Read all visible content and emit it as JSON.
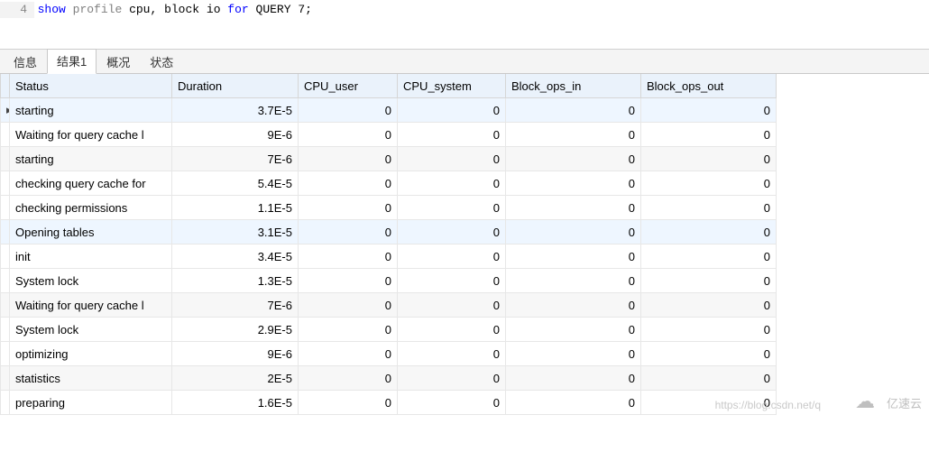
{
  "editor": {
    "line_no": "4",
    "tok_show": "show",
    "tok_profile": "profile",
    "tok_mid": " cpu, block io ",
    "tok_for": "for",
    "tok_query": " QUERY ",
    "tok_tail": "7;"
  },
  "tabs": {
    "info": "信息",
    "result1": "结果1",
    "overview": "概况",
    "status": "状态"
  },
  "columns": {
    "status": "Status",
    "duration": "Duration",
    "cpu_user": "CPU_user",
    "cpu_system": "CPU_system",
    "block_ops_in": "Block_ops_in",
    "block_ops_out": "Block_ops_out"
  },
  "rows": [
    {
      "status": "starting",
      "duration": "3.7E-5",
      "cpu_user": "0",
      "cpu_system": "0",
      "in": "0",
      "out": "0",
      "mark": "▸",
      "hl": true
    },
    {
      "status": "Waiting for query cache l",
      "duration": "9E-6",
      "cpu_user": "0",
      "cpu_system": "0",
      "in": "0",
      "out": "0"
    },
    {
      "status": "starting",
      "duration": "7E-6",
      "cpu_user": "0",
      "cpu_system": "0",
      "in": "0",
      "out": "0",
      "even": true
    },
    {
      "status": "checking query cache for",
      "duration": "5.4E-5",
      "cpu_user": "0",
      "cpu_system": "0",
      "in": "0",
      "out": "0"
    },
    {
      "status": "checking permissions",
      "duration": "1.1E-5",
      "cpu_user": "0",
      "cpu_system": "0",
      "in": "0",
      "out": "0"
    },
    {
      "status": "Opening tables",
      "duration": "3.1E-5",
      "cpu_user": "0",
      "cpu_system": "0",
      "in": "0",
      "out": "0",
      "hl": true
    },
    {
      "status": "init",
      "duration": "3.4E-5",
      "cpu_user": "0",
      "cpu_system": "0",
      "in": "0",
      "out": "0"
    },
    {
      "status": "System lock",
      "duration": "1.3E-5",
      "cpu_user": "0",
      "cpu_system": "0",
      "in": "0",
      "out": "0"
    },
    {
      "status": "Waiting for query cache l",
      "duration": "7E-6",
      "cpu_user": "0",
      "cpu_system": "0",
      "in": "0",
      "out": "0",
      "even": true
    },
    {
      "status": "System lock",
      "duration": "2.9E-5",
      "cpu_user": "0",
      "cpu_system": "0",
      "in": "0",
      "out": "0"
    },
    {
      "status": "optimizing",
      "duration": "9E-6",
      "cpu_user": "0",
      "cpu_system": "0",
      "in": "0",
      "out": "0"
    },
    {
      "status": "statistics",
      "duration": "2E-5",
      "cpu_user": "0",
      "cpu_system": "0",
      "in": "0",
      "out": "0",
      "even": true
    },
    {
      "status": "preparing",
      "duration": "1.6E-5",
      "cpu_user": "0",
      "cpu_system": "0",
      "in": "0",
      "out": "0"
    }
  ],
  "watermark": {
    "url": "https://blog.csdn.net/q",
    "brand": "亿速云"
  },
  "colw": {
    "mark": 10,
    "status": 180,
    "duration": 140,
    "cpu_user": 110,
    "cpu_system": 120,
    "in": 150,
    "out": 150
  }
}
